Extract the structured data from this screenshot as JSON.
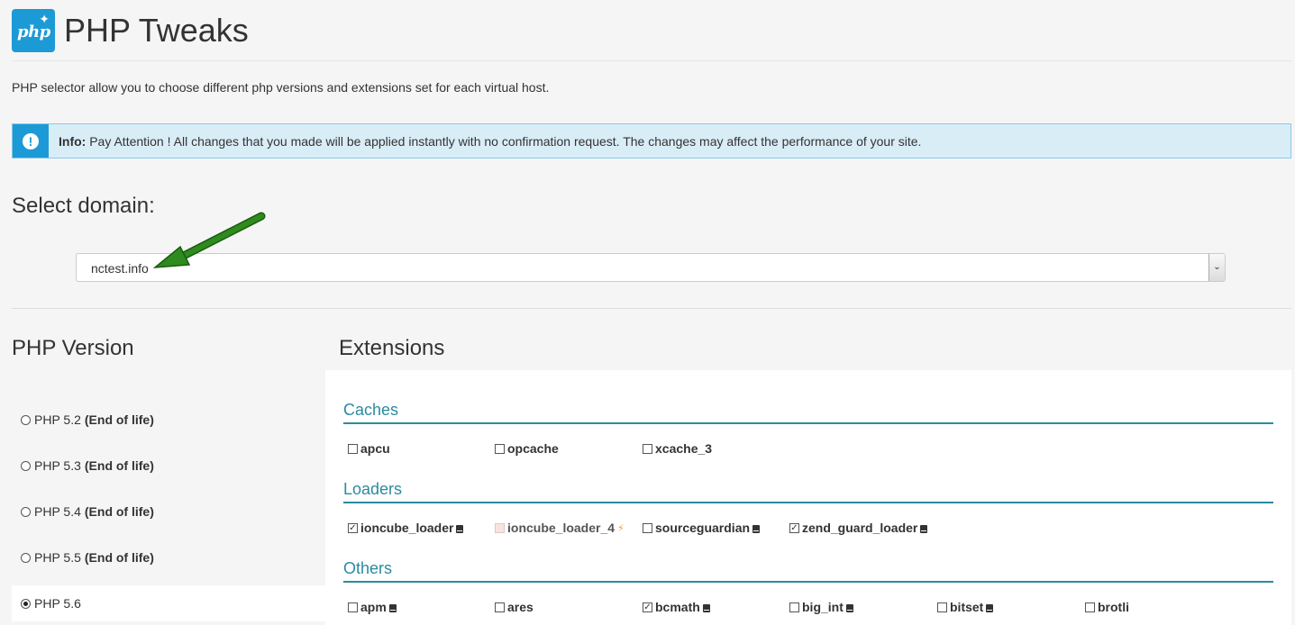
{
  "header": {
    "title": "PHP Tweaks",
    "logo_text": "php",
    "logo_icon": "sparkle-icon"
  },
  "description": "PHP selector allow you to choose different php versions and extensions set for each virtual host.",
  "info": {
    "label": "Info:",
    "text": "Pay Attention ! All changes that you made will be applied instantly with no confirmation request. The changes may affect the performance of your site.",
    "icon": "exclamation-icon"
  },
  "domain": {
    "label": "Select domain:",
    "selected": "nctest.info",
    "caret": "⌄"
  },
  "php_version": {
    "heading": "PHP Version",
    "items": [
      {
        "label": "PHP 5.2",
        "note": "(End of life)",
        "selected": false
      },
      {
        "label": "PHP 5.3",
        "note": "(End of life)",
        "selected": false
      },
      {
        "label": "PHP 5.4",
        "note": "(End of life)",
        "selected": false
      },
      {
        "label": "PHP 5.5",
        "note": "(End of life)",
        "selected": false
      },
      {
        "label": "PHP 5.6",
        "note": "",
        "selected": true
      }
    ]
  },
  "extensions": {
    "heading": "Extensions",
    "groups": [
      {
        "title": "Caches",
        "items": [
          {
            "name": "apcu",
            "checked": false
          },
          {
            "name": "opcache",
            "checked": false
          },
          {
            "name": "xcache_3",
            "checked": false
          }
        ]
      },
      {
        "title": "Loaders",
        "items": [
          {
            "name": "ioncube_loader",
            "checked": true,
            "doc": true
          },
          {
            "name": "ioncube_loader_4",
            "checked": false,
            "disabled": true,
            "bolt": "⚡"
          },
          {
            "name": "sourceguardian",
            "checked": false,
            "doc": true
          },
          {
            "name": "zend_guard_loader",
            "checked": true,
            "doc": true
          }
        ]
      },
      {
        "title": "Others",
        "items": [
          {
            "name": "apm",
            "checked": false,
            "doc": true
          },
          {
            "name": "ares",
            "checked": false
          },
          {
            "name": "bcmath",
            "checked": true,
            "doc": true
          },
          {
            "name": "big_int",
            "checked": false,
            "doc": true
          },
          {
            "name": "bitset",
            "checked": false,
            "doc": true
          },
          {
            "name": "brotli",
            "checked": false
          }
        ]
      }
    ]
  },
  "colors": {
    "accent": "#1c9ad6",
    "group_title": "#2d8aa0",
    "info_bg": "#d9edf7",
    "arrow": "#2e8b1e"
  }
}
